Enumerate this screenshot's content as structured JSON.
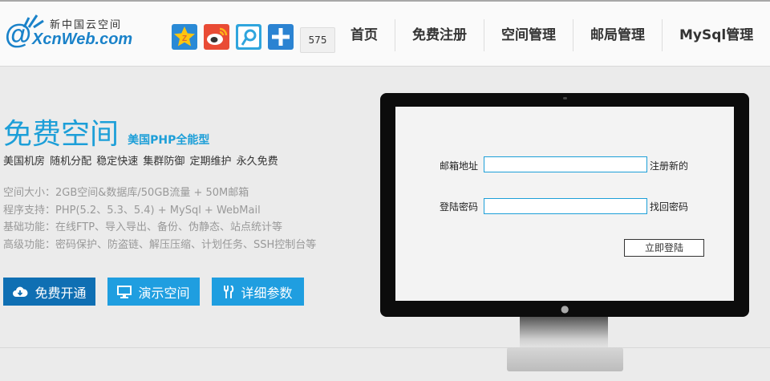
{
  "header": {
    "logo_cn": "新中国云空间",
    "logo_en": "XcnWeb.com",
    "share_count": "575",
    "social_icons": [
      "qzone-icon",
      "weibo-icon",
      "tencent-weibo-icon",
      "share-plus-icon"
    ]
  },
  "nav": {
    "items": [
      "首页",
      "免费注册",
      "空间管理",
      "邮局管理",
      "MySql管理"
    ]
  },
  "hero": {
    "title": "免费空间",
    "subtitle": "美国PHP全能型",
    "features": "美国机房 随机分配 稳定快速 集群防御 定期维护 永久免费",
    "specs": [
      "空间大小：2GB空间&数据库/50GB流量 + 50M邮箱",
      "程序支持：PHP(5.2、5.3、5.4) + MySql + WebMail",
      "基础功能：在线FTP、导入导出、备份、伪静态、站点统计等",
      "高级功能：密码保护、防盗链、解压压缩、计划任务、SSH控制台等"
    ],
    "buttons": {
      "register": "免费开通",
      "demo": "演示空间",
      "detail": "详细参数"
    }
  },
  "login": {
    "email_label": "邮箱地址",
    "email_value": "",
    "register_link": "注册新的",
    "password_label": "登陆密码",
    "password_value": "",
    "forgot_link": "找回密码",
    "submit": "立即登陆"
  },
  "colors": {
    "brand_blue": "#1d9fd8",
    "dark_blue": "#0f6fb3",
    "page_bg": "#ebebeb"
  }
}
